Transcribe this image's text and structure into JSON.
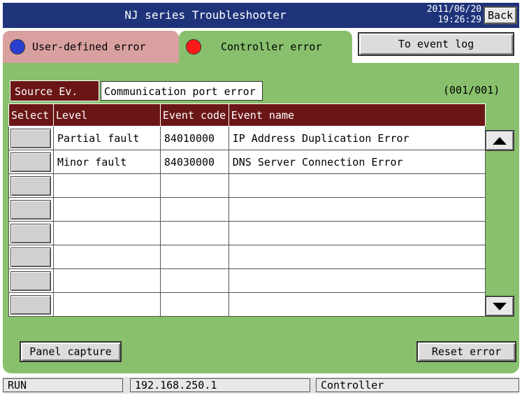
{
  "colors": {
    "titlebar": "#1f337a",
    "tab_user": "#d9a0a0",
    "tab_controller": "#88c06d",
    "header_bg": "#6b1616",
    "dot_user": "#2a3ed0",
    "dot_controller": "#ff1a1a"
  },
  "titlebar": {
    "title": "NJ series Troubleshooter",
    "date": "2011/06/20",
    "time": "19:26:29",
    "back_label": "Back"
  },
  "tabs": {
    "user_label": "User-defined error",
    "controller_label": "Controller error",
    "event_log_label": "To event log"
  },
  "source": {
    "label": "Source Ev.",
    "value": "Communication port error",
    "page_counter": "(001/001)"
  },
  "table": {
    "headers": [
      "Select",
      "Level",
      "Event code",
      "Event name"
    ],
    "rows": [
      {
        "level": "Partial fault",
        "code": "84010000",
        "name": "IP Address Duplication Error"
      },
      {
        "level": "Minor fault",
        "code": "84030000",
        "name": "DNS Server Connection Error"
      },
      {
        "level": "",
        "code": "",
        "name": ""
      },
      {
        "level": "",
        "code": "",
        "name": ""
      },
      {
        "level": "",
        "code": "",
        "name": ""
      },
      {
        "level": "",
        "code": "",
        "name": ""
      },
      {
        "level": "",
        "code": "",
        "name": ""
      },
      {
        "level": "",
        "code": "",
        "name": ""
      }
    ]
  },
  "icons": {
    "scroll_up": "triangle-up-icon",
    "scroll_down": "triangle-down-icon"
  },
  "footer": {
    "panel_capture_label": "Panel capture",
    "reset_error_label": "Reset error"
  },
  "status": {
    "mode": "RUN",
    "ip": "192.168.250.1",
    "target": "Controller"
  }
}
